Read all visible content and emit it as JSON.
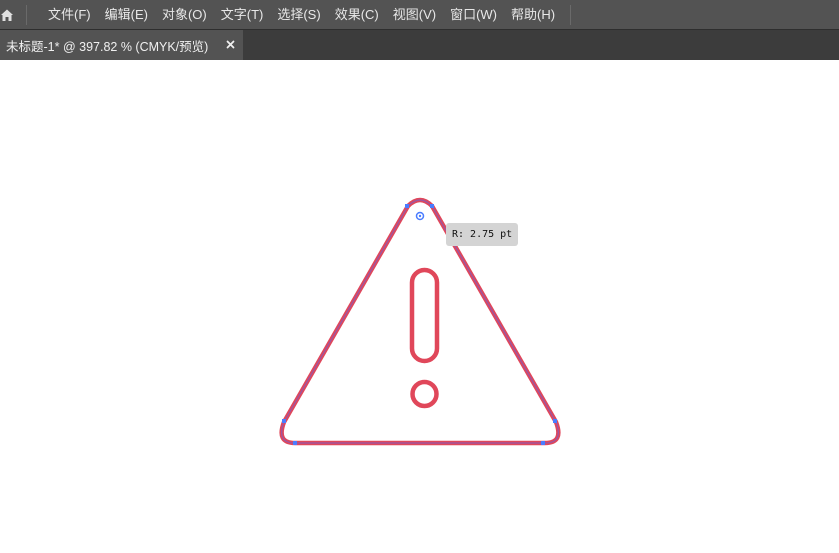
{
  "menubar": {
    "items": [
      {
        "label": "文件(F)"
      },
      {
        "label": "编辑(E)"
      },
      {
        "label": "对象(O)"
      },
      {
        "label": "文字(T)"
      },
      {
        "label": "选择(S)"
      },
      {
        "label": "效果(C)"
      },
      {
        "label": "视图(V)"
      },
      {
        "label": "窗口(W)"
      },
      {
        "label": "帮助(H)"
      }
    ]
  },
  "document_tab": {
    "title": "未标题-1* @ 397.82 % (CMYK/预览)",
    "close_glyph": "×"
  },
  "canvas": {
    "radius_tooltip": "R: 2.75 pt"
  },
  "colors": {
    "menubar_bg": "#535353",
    "tabbar_bg": "#3c3c3c",
    "artwork_stroke": "#e0475a",
    "selection_path": "#8a5ab5",
    "anchor_point": "#4a7cff"
  }
}
